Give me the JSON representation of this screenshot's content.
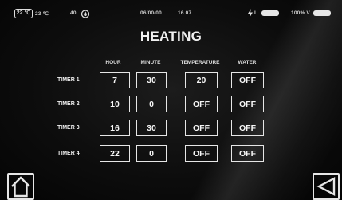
{
  "status_bar": {
    "temp_badge": "22 ℃",
    "temp": "23 ℃",
    "humidity": "40",
    "date": "06/00/00",
    "time": "16 07",
    "signal_label": "L",
    "battery_label": "100% V"
  },
  "title": "HEATING",
  "columns": {
    "hour": "HOUR",
    "minute": "MINUTE",
    "temperature": "TEMPERATURE",
    "water": "WATER"
  },
  "timers": [
    {
      "label": "TIMER 1",
      "hour": "7",
      "minute": "30",
      "temperature": "20",
      "water": "OFF"
    },
    {
      "label": "TIMER 2",
      "hour": "10",
      "minute": "0",
      "temperature": "OFF",
      "water": "OFF"
    },
    {
      "label": "TIMER 3",
      "hour": "16",
      "minute": "30",
      "temperature": "OFF",
      "water": "OFF"
    },
    {
      "label": "TIMER 4",
      "hour": "22",
      "minute": "0",
      "temperature": "OFF",
      "water": "OFF"
    }
  ],
  "icons": {
    "home": "home-icon",
    "back": "back-triangle-icon",
    "humidity": "water-drop-icon",
    "signal": "lightning-icon"
  }
}
